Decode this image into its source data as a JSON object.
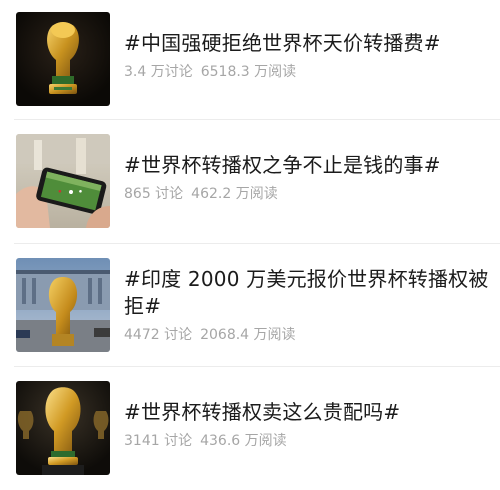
{
  "topics": [
    {
      "title": "#中国强硬拒绝世界杯天价转播费#",
      "discussions": "3.4 万讨论",
      "reads": "6518.3 万阅读",
      "thumbnail_icon": "world-cup-trophy-icon"
    },
    {
      "title": "#世界杯转播权之争不止是钱的事#",
      "discussions": "865 讨论",
      "reads": "462.2 万阅读",
      "thumbnail_icon": "phone-streaming-soccer-icon"
    },
    {
      "title": "#印度 2000 万美元报价世界杯转播权被拒#",
      "discussions": "4472 讨论",
      "reads": "2068.4 万阅读",
      "thumbnail_icon": "trophy-statue-stadium-icon"
    },
    {
      "title": "#世界杯转播权卖这么贵配吗#",
      "discussions": "3141 讨论",
      "reads": "436.6 万阅读",
      "thumbnail_icon": "trophy-display-case-icon"
    }
  ],
  "colors": {
    "title_text": "#1b1b1b",
    "meta_text": "#a6a6a6",
    "divider": "#ececec",
    "background": "#ffffff"
  }
}
